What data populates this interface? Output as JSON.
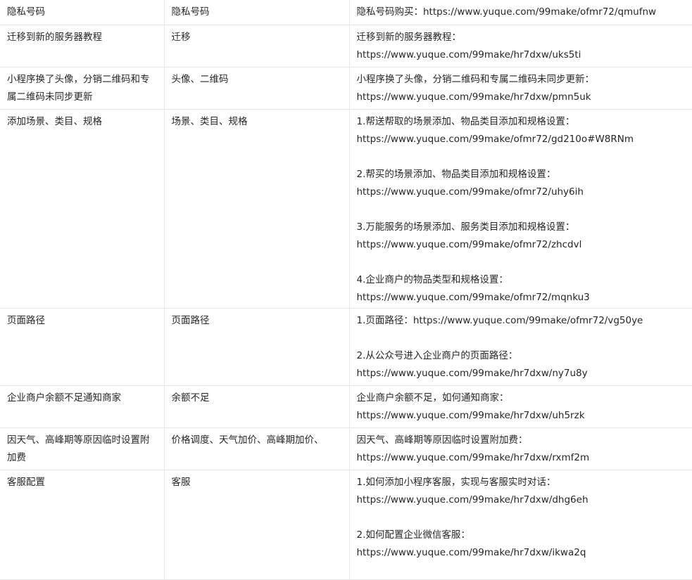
{
  "rows": [
    {
      "topic": "隐私号码",
      "keywords": "隐私号码",
      "paragraphs": [
        [
          "隐私号码购买：https://www.yuque.com/99make/ofmr72/qmufnw"
        ]
      ]
    },
    {
      "topic": "迁移到新的服务器教程",
      "keywords": "迁移",
      "paragraphs": [
        [
          "迁移到新的服务器教程：",
          "https://www.yuque.com/99make/hr7dxw/uks5ti"
        ]
      ]
    },
    {
      "topic": "小程序换了头像，分销二维码和专属二维码未同步更新",
      "keywords": "头像、二维码",
      "paragraphs": [
        [
          "小程序换了头像，分销二维码和专属二维码未同步更新：",
          "https://www.yuque.com/99make/hr7dxw/pmn5uk"
        ]
      ]
    },
    {
      "topic": "添加场景、类目、规格",
      "keywords": "场景、类目、规格",
      "paragraphs": [
        [
          "1.帮送帮取的场景添加、物品类目添加和规格设置：",
          "https://www.yuque.com/99make/ofmr72/gd210o#W8RNm"
        ],
        [
          "2.帮买的场景添加、物品类目添加和规格设置：",
          "https://www.yuque.com/99make/ofmr72/uhy6ih"
        ],
        [
          "3.万能服务的场景添加、服务类目添加和规格设置：",
          "https://www.yuque.com/99make/ofmr72/zhcdvl"
        ],
        [
          "4.企业商户的物品类型和规格设置：",
          "https://www.yuque.com/99make/ofmr72/mqnku3"
        ]
      ]
    },
    {
      "topic": "页面路径",
      "keywords": "页面路径",
      "paragraphs": [
        [
          "1.页面路径：https://www.yuque.com/99make/ofmr72/vg50ye"
        ],
        [
          "2.从公众号进入企业商户的页面路径：",
          "https://www.yuque.com/99make/hr7dxw/ny7u8y"
        ]
      ]
    },
    {
      "topic": "企业商户余额不足通知商家",
      "keywords": "余额不足",
      "paragraphs": [
        [
          "企业商户余额不足，如何通知商家：",
          "https://www.yuque.com/99make/hr7dxw/uh5rzk"
        ]
      ]
    },
    {
      "topic": "因天气、高峰期等原因临时设置附加费",
      "keywords": "价格调度、天气加价、高峰期加价、",
      "paragraphs": [
        [
          "因天气、高峰期等原因临时设置附加费：",
          "https://www.yuque.com/99make/hr7dxw/rxmf2m"
        ]
      ]
    },
    {
      "topic": "客服配置",
      "keywords": "客服",
      "paragraphs": [
        [
          "1.如何添加小程序客服，实现与客服实时对话：",
          "https://www.yuque.com/99make/hr7dxw/dhg6eh"
        ],
        [
          "2.如何配置企业微信客服：",
          "https://www.yuque.com/99make/hr7dxw/ikwa2q"
        ]
      ]
    }
  ]
}
